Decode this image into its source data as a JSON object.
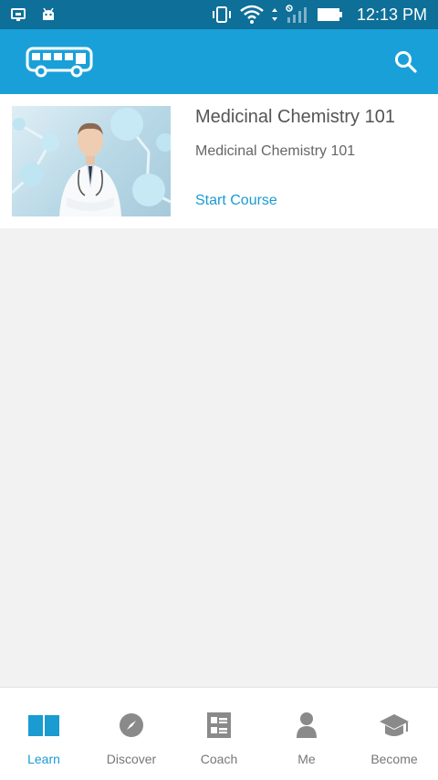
{
  "status_bar": {
    "time": "12:13 PM",
    "icons": [
      "usb-icon",
      "android-icon",
      "vibrate-icon",
      "wifi-icon",
      "no-sim-icon",
      "signal-icon",
      "battery-icon"
    ]
  },
  "app_bar": {
    "logo_icon": "bus-logo-icon",
    "search_icon": "search-icon",
    "color": "#1aa0d8"
  },
  "course": {
    "title": "Medicinal Chemistry 101",
    "subtitle": "Medicinal Chemistry 101",
    "cta": "Start Course",
    "thumbnail": "doctor-molecules-image"
  },
  "bottom_nav": {
    "active": "Learn",
    "items": [
      {
        "label": "Learn",
        "icon": "book-icon"
      },
      {
        "label": "Discover",
        "icon": "compass-icon"
      },
      {
        "label": "Coach",
        "icon": "checklist-icon"
      },
      {
        "label": "Me",
        "icon": "person-icon"
      },
      {
        "label": "Become",
        "icon": "graduation-cap-icon"
      }
    ]
  },
  "colors": {
    "primary": "#1aa0d8",
    "status_bar": "#0e6f99",
    "accent_text": "#1a9bd1",
    "background": "#f2f2f2"
  }
}
